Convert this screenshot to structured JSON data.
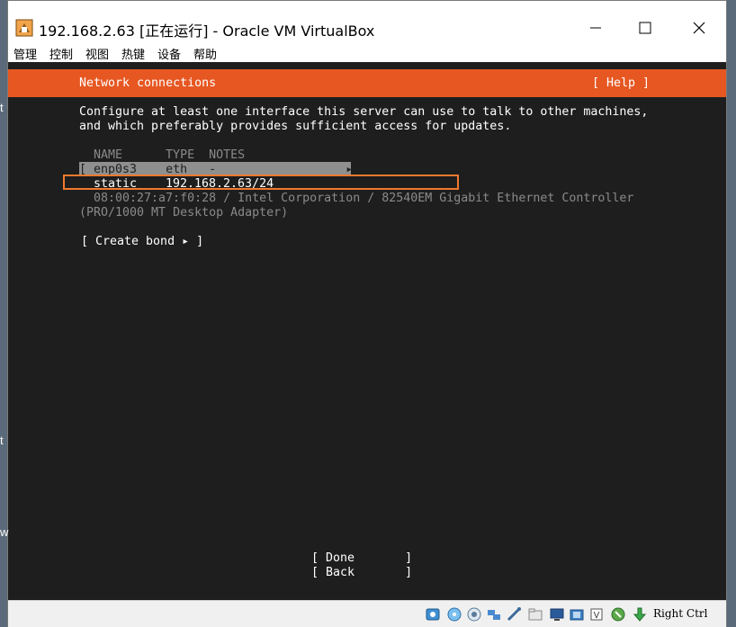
{
  "window": {
    "title": "192.168.2.63 [正在运行] - Oracle VM VirtualBox"
  },
  "menu": [
    "管理",
    "控制",
    "视图",
    "热键",
    "设备",
    "帮助"
  ],
  "header": {
    "title": "Network connections",
    "help": "[ Help ]"
  },
  "intro": {
    "line1": "Configure at least one interface this server can use to talk to other machines,",
    "line2": "and which preferably provides sufficient access for updates."
  },
  "table": {
    "columns": "NAME      TYPE  NOTES",
    "interface_row": "[ enp0s3    eth   -                  ▸ ]",
    "addr_method": "static",
    "address": "192.168.2.63/24",
    "hw_line1": "08:00:27:a7:f0:28 / Intel Corporation / 82540EM Gigabit Ethernet Controller",
    "hw_line2": "(PRO/1000 MT Desktop Adapter)"
  },
  "create_bond": "[ Create bond ▸ ]",
  "actions": {
    "done": "[ Done       ]",
    "back": "[ Back       ]"
  },
  "statusbar": {
    "host_key": "Right Ctrl"
  },
  "edge_chars": [
    "t",
    "t",
    "w"
  ]
}
